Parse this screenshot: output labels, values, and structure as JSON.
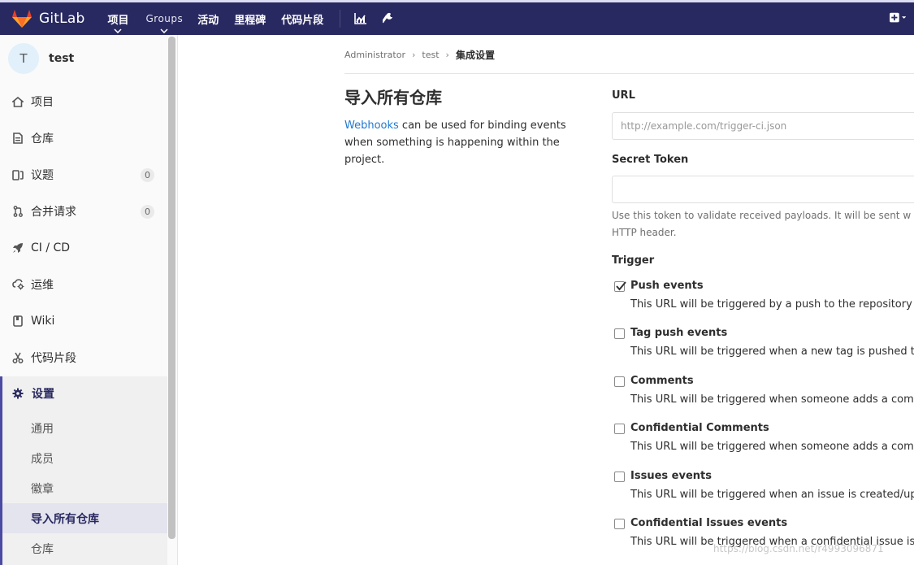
{
  "topbar": {
    "brand": "GitLab",
    "nav": [
      {
        "label": "项目",
        "dropdown": true
      },
      {
        "label": "Groups",
        "dropdown": true
      },
      {
        "label": "活动",
        "dropdown": false
      },
      {
        "label": "里程碑",
        "dropdown": false
      },
      {
        "label": "代码片段",
        "dropdown": false
      }
    ],
    "icons": [
      "chart-icon",
      "wrench-icon",
      "plus-square-icon"
    ]
  },
  "sidebar": {
    "project_avatar": "T",
    "project_name": "test",
    "items": [
      {
        "label": "项目",
        "icon": "home-icon"
      },
      {
        "label": "仓库",
        "icon": "doc-icon"
      },
      {
        "label": "议题",
        "icon": "issues-icon",
        "count": "0"
      },
      {
        "label": "合并请求",
        "icon": "merge-icon",
        "count": "0"
      },
      {
        "label": "CI / CD",
        "icon": "rocket-icon"
      },
      {
        "label": "运维",
        "icon": "cloud-gear-icon"
      },
      {
        "label": "Wiki",
        "icon": "book-icon"
      },
      {
        "label": "代码片段",
        "icon": "scissors-icon"
      }
    ],
    "settings": {
      "label": "设置",
      "sub_items": [
        "通用",
        "成员",
        "徽章",
        "导入所有仓库",
        "仓库"
      ],
      "active_index": 3
    }
  },
  "breadcrumb": [
    "Administrator",
    "test",
    "集成设置"
  ],
  "main": {
    "title": "导入所有仓库",
    "desc_link": "Webhooks",
    "desc_text": " can be used for binding events when something is happening within the project.",
    "url_label": "URL",
    "url_placeholder": "http://example.com/trigger-ci.json",
    "token_label": "Secret Token",
    "token_help_1": "Use this token to validate received payloads. It will be sent w",
    "token_help_2": "HTTP header.",
    "trigger_label": "Trigger",
    "triggers": [
      {
        "name": "Push events",
        "desc": "This URL will be triggered by a push to the repository",
        "checked": true
      },
      {
        "name": "Tag push events",
        "desc": "This URL will be triggered when a new tag is pushed to",
        "checked": false
      },
      {
        "name": "Comments",
        "desc": "This URL will be triggered when someone adds a comme",
        "checked": false
      },
      {
        "name": "Confidential Comments",
        "desc": "This URL will be triggered when someone adds a comme",
        "checked": false
      },
      {
        "name": "Issues events",
        "desc": "This URL will be triggered when an issue is created/upda",
        "checked": false
      },
      {
        "name": "Confidential Issues events",
        "desc": "This URL will be triggered when a confidential issue is cr",
        "checked": false
      }
    ]
  },
  "watermark": "https://blog.csdn.net/r4993096871"
}
